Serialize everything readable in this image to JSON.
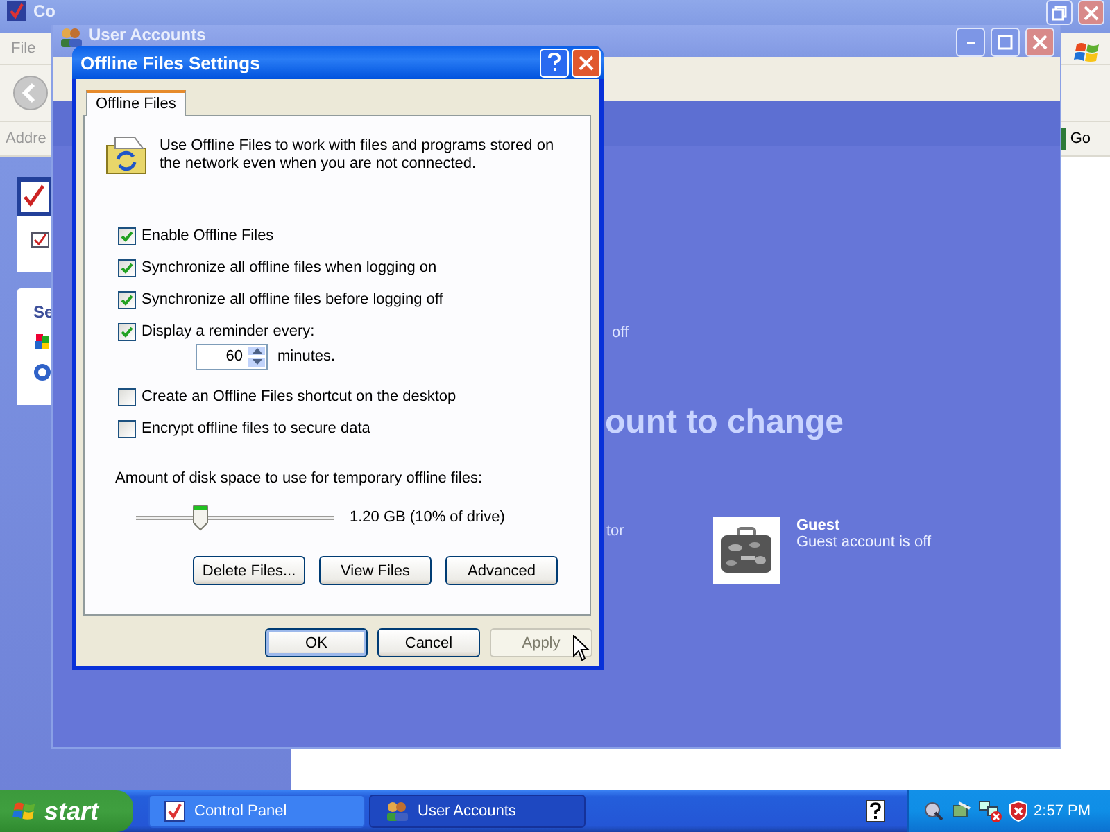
{
  "control_panel": {
    "title": "Co",
    "menu": [
      "File"
    ],
    "address_label": "Addre",
    "go_button": "Go",
    "task_pane_heading": "Se"
  },
  "user_accounts": {
    "title": "User Accounts",
    "status_fragment": "off",
    "heading": "ount to change",
    "account_fragment": "tor",
    "guest": {
      "name": "Guest",
      "status": "Guest account is off"
    }
  },
  "dialog": {
    "title": "Offline Files Settings",
    "tabs": [
      {
        "label": "Offline Files",
        "selected": true
      }
    ],
    "description": "Use Offline Files to work with files and programs stored on the network even when you are not connected.",
    "options": [
      {
        "label": "Enable Offline Files",
        "checked": true
      },
      {
        "label": "Synchronize all offline files when logging on",
        "checked": true
      },
      {
        "label": "Synchronize all offline files before logging off",
        "checked": true
      },
      {
        "label": "Display a reminder every:",
        "checked": true
      }
    ],
    "reminder": {
      "value": "60",
      "unit": "minutes."
    },
    "more_options": [
      {
        "label": "Create an Offline Files shortcut on the desktop",
        "checked": false
      },
      {
        "label": "Encrypt offline files to secure data",
        "checked": false
      }
    ],
    "disk_label": "Amount of disk space to use for temporary offline files:",
    "disk_slider": {
      "level": 0.33
    },
    "disk_reading": "1.20 GB (10% of drive)",
    "action_buttons": [
      {
        "label": "Delete Files...",
        "disabled": false
      },
      {
        "label": "View Files",
        "disabled": false
      },
      {
        "label": "Advanced",
        "disabled": false
      }
    ],
    "buttons": [
      {
        "label": "OK",
        "default": true,
        "disabled": false
      },
      {
        "label": "Cancel",
        "default": false,
        "disabled": false
      },
      {
        "label": "Apply",
        "default": false,
        "disabled": true
      }
    ]
  },
  "taskbar": {
    "start": "start",
    "tasks": [
      {
        "label": "Control Panel",
        "selected": false
      },
      {
        "label": "User Accounts",
        "selected": true
      }
    ],
    "clock": "2:57 PM"
  }
}
